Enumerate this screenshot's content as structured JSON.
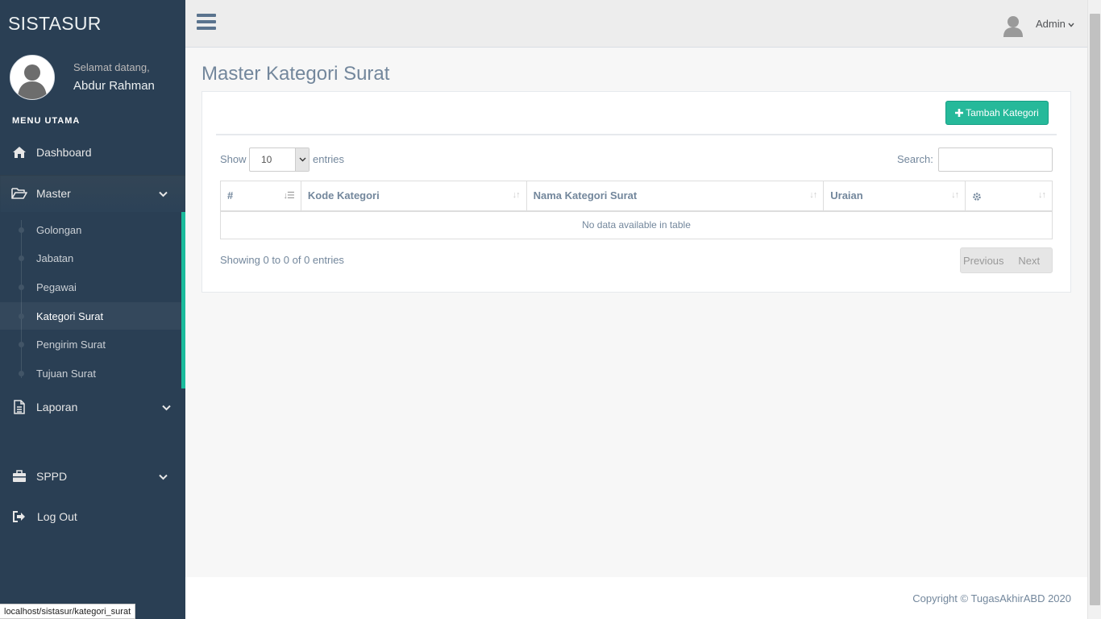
{
  "sidebar": {
    "brand": "SISTASUR",
    "welcome": "Selamat datang,",
    "user_name": "Abdur Rahman",
    "menu_heading": "MENU UTAMA",
    "items": [
      {
        "label": "Dashboard",
        "icon": "home-icon"
      },
      {
        "label": "Master",
        "icon": "folder-open-icon",
        "expanded": true,
        "children": [
          "Golongan",
          "Jabatan",
          "Pegawai",
          "Kategori Surat",
          "Pengirim Surat",
          "Tujuan Surat"
        ],
        "active_child": "Kategori Surat"
      },
      {
        "label": "Laporan",
        "icon": "document-icon"
      },
      {
        "label": "SPPD",
        "icon": "briefcase-icon"
      },
      {
        "label": "Log Out",
        "icon": "sign-out-icon"
      }
    ]
  },
  "topbar": {
    "user_label": "Admin"
  },
  "main": {
    "title": "Master Kategori Surat",
    "add_button": "Tambah Kategori",
    "show_label": "Show",
    "page_length": "10",
    "entries_label": "entries",
    "search_label": "Search:",
    "search_value": "",
    "table": {
      "columns": [
        "#",
        "Kode Kategori",
        "Nama Kategori Surat",
        "Uraian",
        ""
      ],
      "empty_message": "No data available in table"
    },
    "info": "Showing 0 to 0 of 0 entries",
    "pager": {
      "previous": "Previous",
      "next": "Next"
    }
  },
  "footer": {
    "copyright": "Copyright © TugasAkhirABD 2020"
  },
  "statusbar": {
    "url": "localhost/sistasur/kategori_surat"
  },
  "colors": {
    "sidebar_bg": "#2A3F54",
    "accent": "#1ABB9C",
    "button": "#26B99A",
    "text": "#73879C"
  }
}
